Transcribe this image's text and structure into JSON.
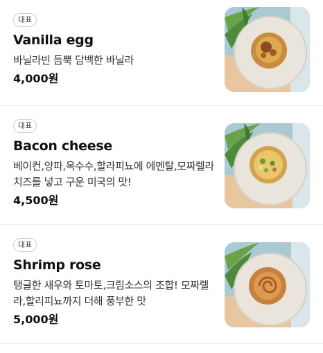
{
  "menu": {
    "items": [
      {
        "badge": "대표",
        "name": "Vanilla egg",
        "description": "바닐라빈 듬뿍 담백한 바닐라",
        "price": "4,000원",
        "image_icon": "vanilla-egg-tart-photo"
      },
      {
        "badge": "대표",
        "name": "Bacon cheese",
        "description": "베이컨,양파,옥수수,할라피뇨에 에멘탈,모짜렐라 치즈를 넣고 구운 미국의 맛!",
        "price": "4,500원",
        "image_icon": "bacon-cheese-tart-photo"
      },
      {
        "badge": "대표",
        "name": "Shrimp rose",
        "description": "탱글한 새우와 토마토,크림소스의 조합! 모짜렐라,할리피뇨까지 더해 풍부한 맛",
        "price": "5,000원",
        "image_icon": "shrimp-rose-tart-photo"
      }
    ]
  },
  "colors": {
    "plate": "#e9e4dc",
    "table_blue": "#9fc3cf",
    "leaf_green": "#4f8a3c",
    "pastry": "#d8a35a"
  }
}
